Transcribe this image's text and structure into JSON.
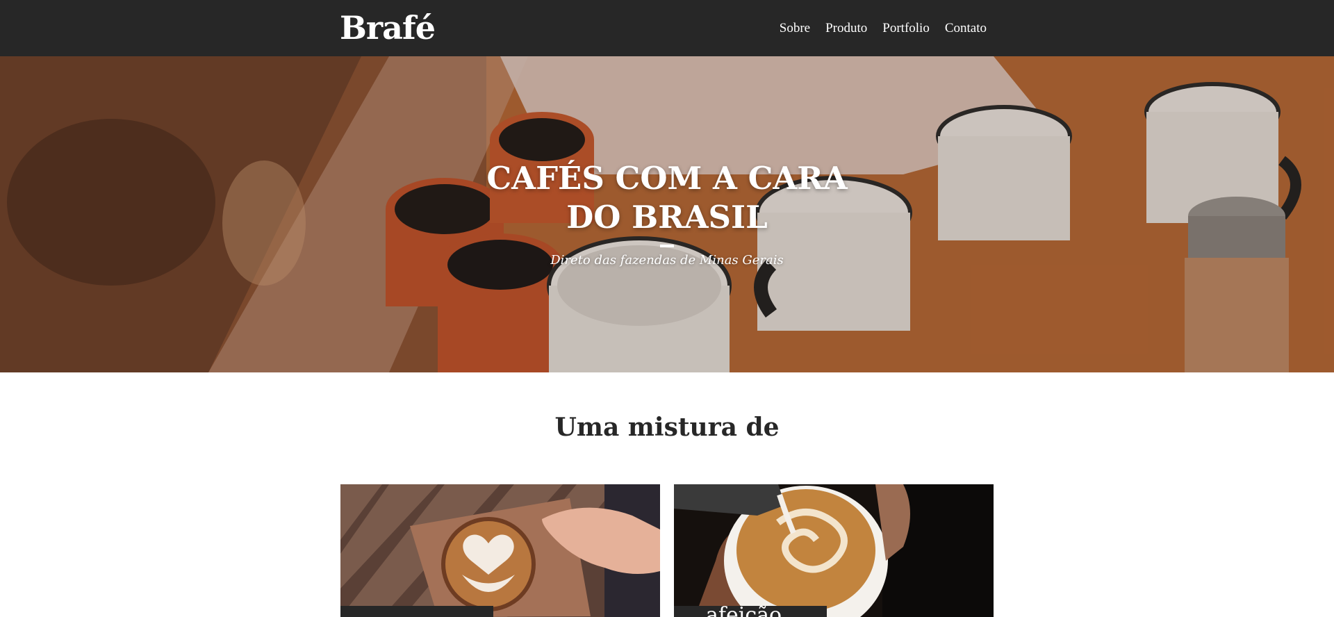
{
  "header": {
    "logo": "Brafé",
    "nav": [
      {
        "label": "Sobre"
      },
      {
        "label": "Produto"
      },
      {
        "label": "Portfolio"
      },
      {
        "label": "Contato"
      }
    ]
  },
  "hero": {
    "title_line1": "CAFÉS COM A CARA",
    "title_line2": "DO BRASIL",
    "subtitle": "Direto das fazendas de Minas Gerais"
  },
  "section": {
    "heading": "Uma mistura de",
    "cards": [
      {
        "caption": "",
        "image": "latte-art-heart-photo"
      },
      {
        "caption": "afeição",
        "image": "latte-pour-photo"
      }
    ]
  },
  "colors": {
    "header_bg": "#272727",
    "text_dark": "#272727",
    "white": "#ffffff"
  }
}
